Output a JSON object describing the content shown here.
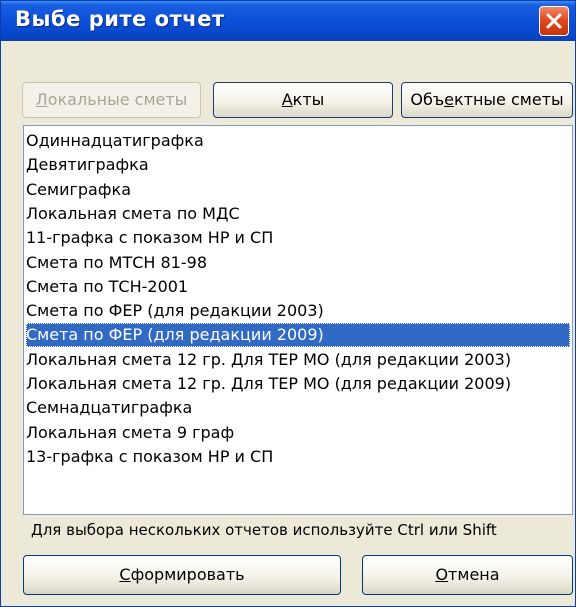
{
  "window": {
    "title": "Выбе рите отчет"
  },
  "tabs": {
    "local": {
      "first": "Л",
      "rest": "окальные сметы",
      "disabled": true
    },
    "acts": {
      "first": "А",
      "rest": "кты"
    },
    "object": {
      "before": "Объ",
      "u": "е",
      "after": "ктные сметы"
    }
  },
  "list": {
    "items": [
      "Одиннадцатиграфка",
      "Девятиграфка",
      "Семиграфка",
      "Локальная смета по МДС",
      "11-графка с показом НР и СП",
      "Смета по МТСН 81-98",
      "Смета по ТСН-2001",
      "Смета по ФЕР (для редакции 2003)",
      "Смета по ФЕР (для редакции 2009)",
      "Локальная смета 12 гр. Для ТЕР МО  (для редакции 2003)",
      "Локальная смета 12 гр. Для ТЕР МО (для редакции 2009)",
      "Семнадцатиграфка",
      "Локальная смета 9 граф",
      "13-графка с показом НР и СП"
    ],
    "selected_index": 8
  },
  "hint": "Для выбора нескольких отчетов используйте Ctrl или Shift",
  "buttons": {
    "generate": {
      "first": "С",
      "rest": "формировать"
    },
    "cancel": {
      "first": "О",
      "rest": "тмена"
    }
  },
  "colors": {
    "selection": "#316ac5",
    "titlebar": "#0a4fd8",
    "close": "#e04a20"
  }
}
